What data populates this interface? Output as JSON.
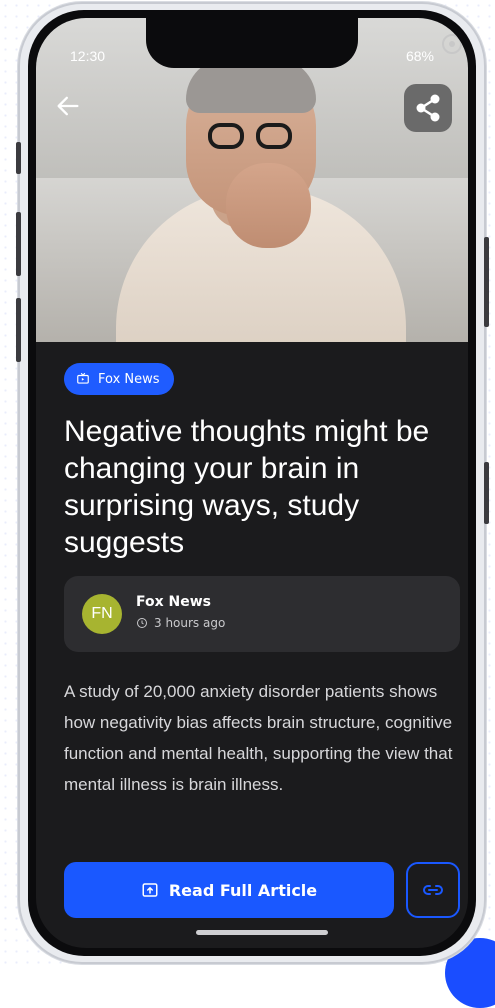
{
  "status_bar": {
    "time": "12:30",
    "battery": "68%"
  },
  "hero": {
    "image_alt": "Man with glasses thinking with hand over mouth"
  },
  "source_pill": {
    "label": "Fox News"
  },
  "article": {
    "headline": "Negative thoughts might be changing your brain in surprising ways, study suggests",
    "summary": "A study of 20,000 anxiety disorder patients shows how negativity bias affects brain structure, cognitive function and mental health, supporting the view that mental illness is brain illness."
  },
  "source_card": {
    "avatar_initials": "FN",
    "name": "Fox News",
    "time_ago": "3 hours ago"
  },
  "actions": {
    "read_full_label": "Read Full Article"
  },
  "icons": {
    "back": "arrow-left-icon",
    "share": "share-icon",
    "tv": "tv-icon",
    "clock": "clock-icon",
    "open": "open-external-icon",
    "link": "link-icon"
  },
  "colors": {
    "accent": "#1A58FF",
    "screen_bg": "#1B1B1D",
    "card_bg": "#2D2D30",
    "avatar": "#A7B430"
  }
}
